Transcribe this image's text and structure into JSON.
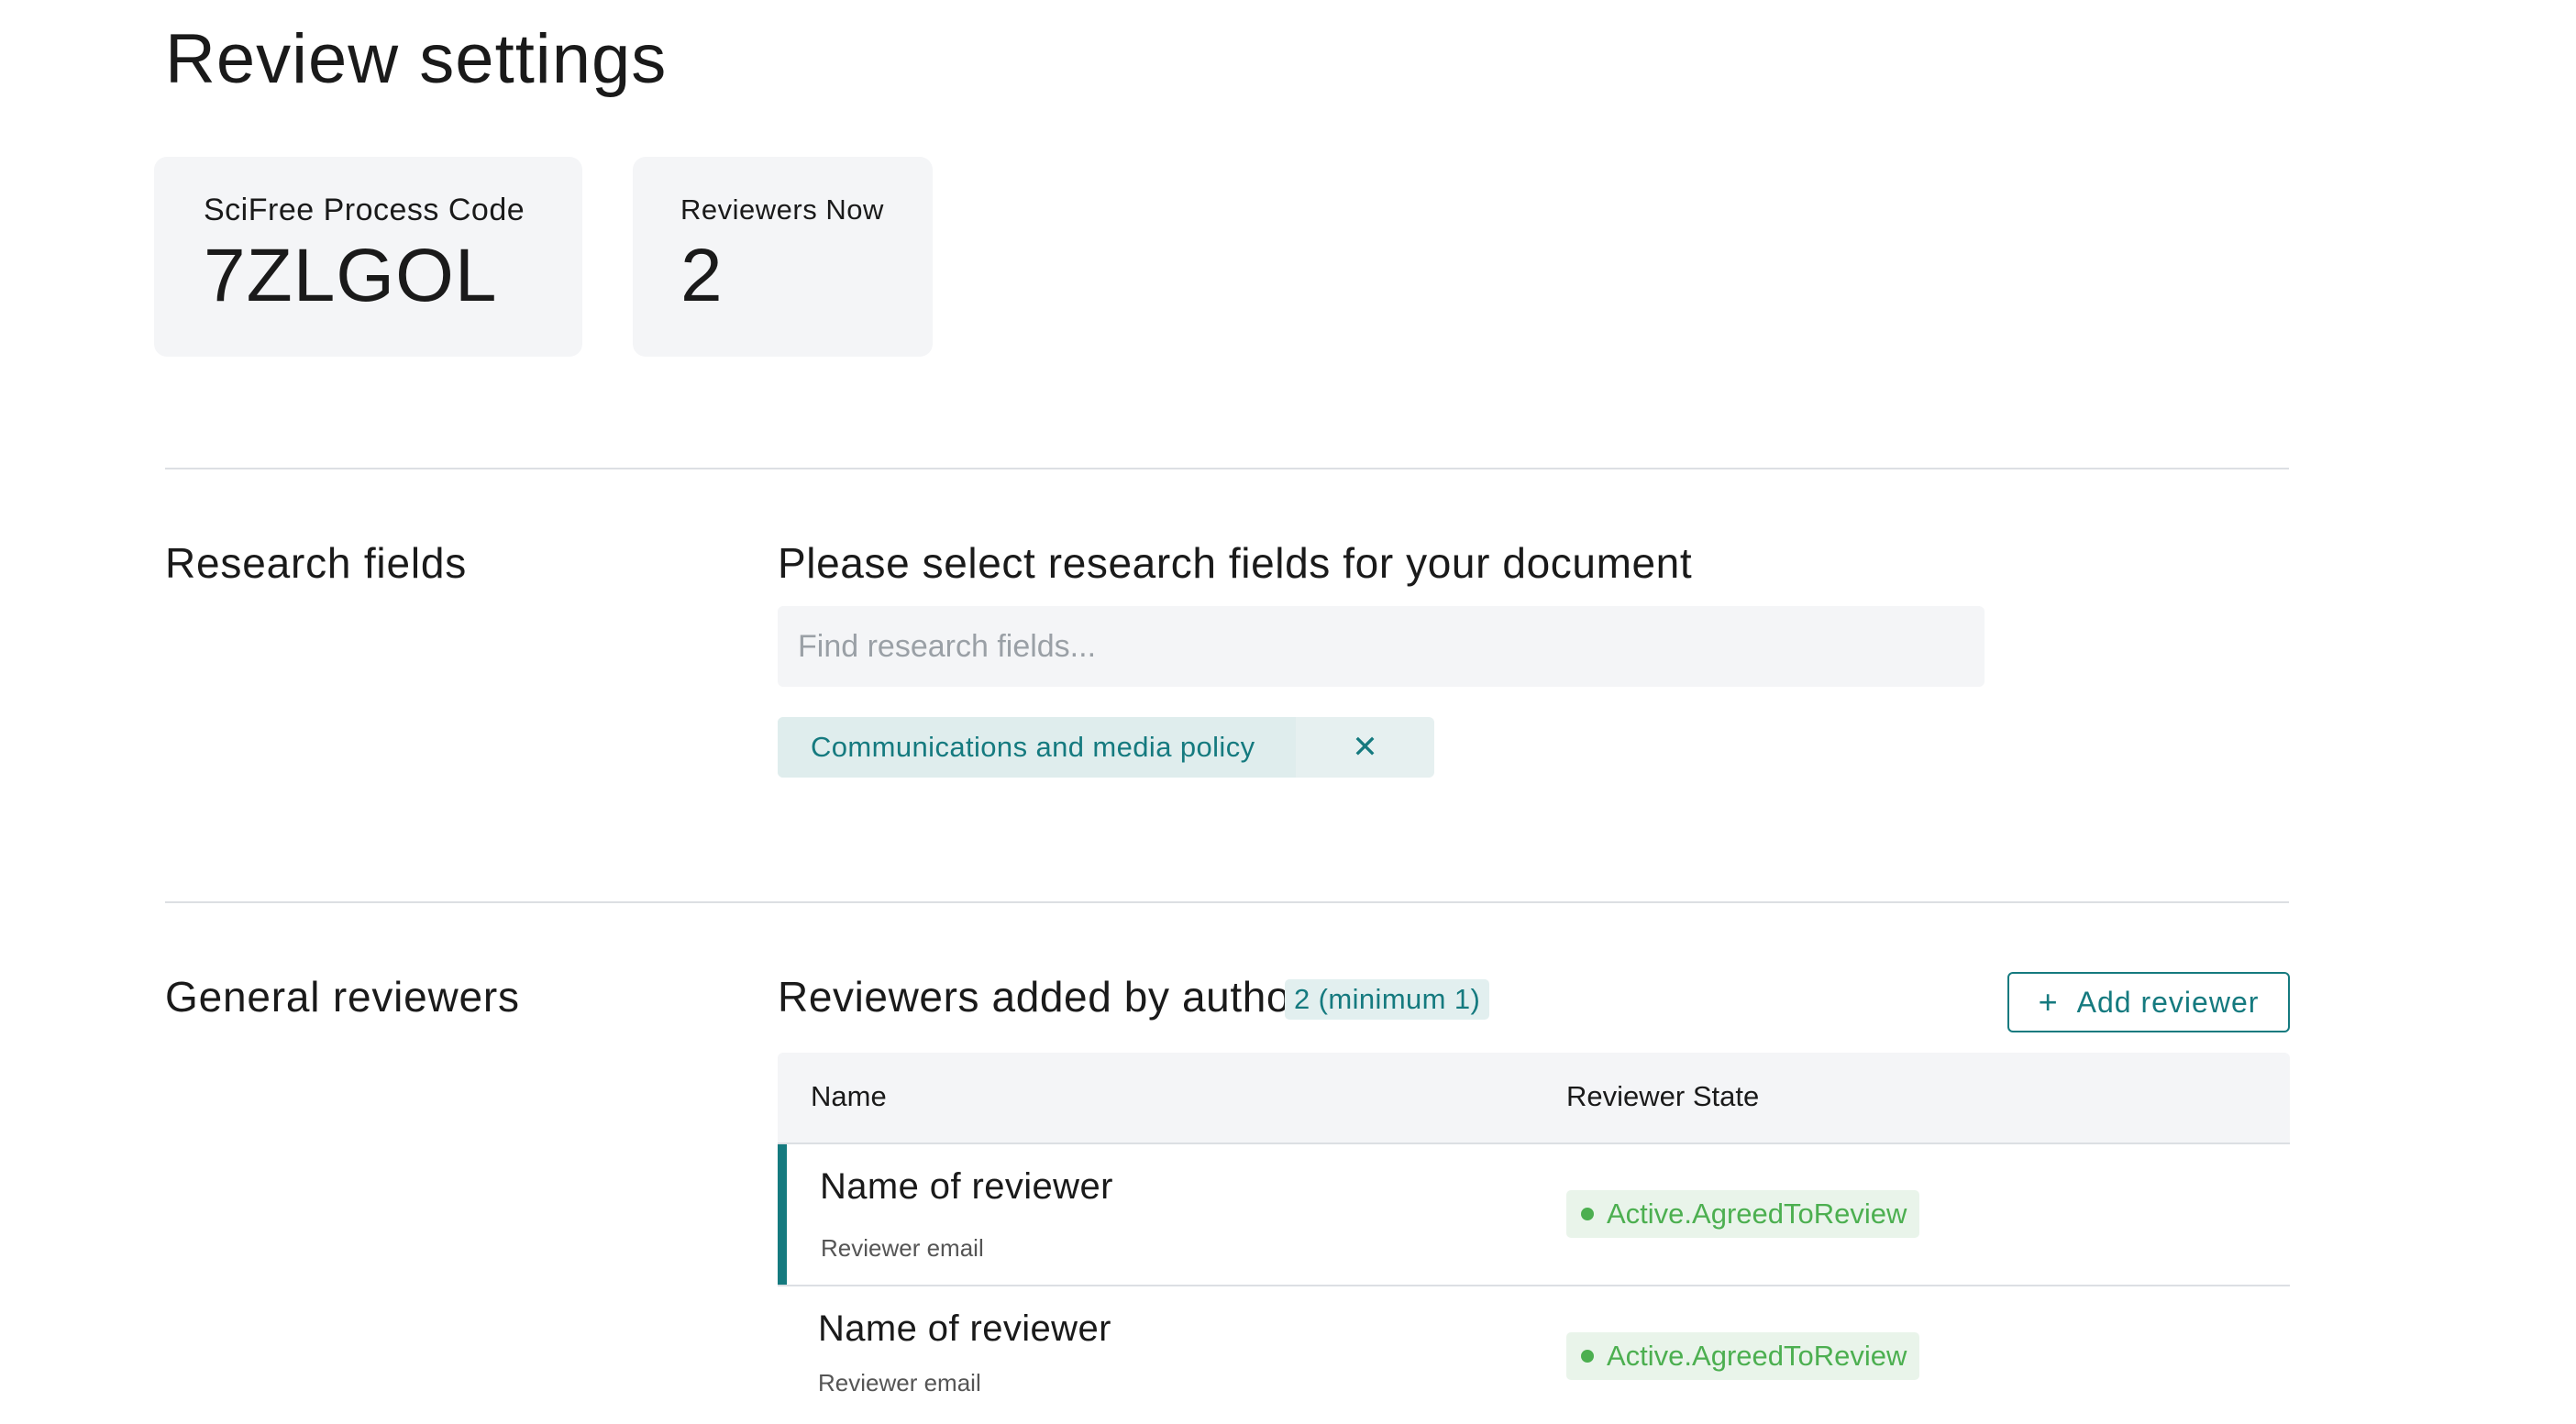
{
  "page": {
    "title": "Review settings"
  },
  "stats": {
    "process_code_label": "SciFree Process Code",
    "process_code_value": "7ZLGOL",
    "reviewers_now_label": "Reviewers Now",
    "reviewers_now_value": "2"
  },
  "research_fields": {
    "section_label": "Research fields",
    "heading": "Please select research fields for your document",
    "search_placeholder": "Find research fields...",
    "search_value": "",
    "selected": [
      {
        "label": "Communications and media policy",
        "remove_icon": "close-icon"
      }
    ]
  },
  "general_reviewers": {
    "section_label": "General reviewers",
    "heading": "Reviewers added by author",
    "count_badge": "2 (minimum 1)",
    "add_button_label": "Add reviewer",
    "add_button_icon": "plus-icon",
    "table": {
      "columns": [
        "Name",
        "Reviewer State"
      ],
      "rows": [
        {
          "name": "Name of reviewer",
          "email": "Reviewer email",
          "state": "Active.AgreedToReview"
        },
        {
          "name": "Name of reviewer",
          "email": "Reviewer email",
          "state": "Active.AgreedToReview"
        }
      ]
    }
  },
  "colors": {
    "accent": "#157a7f",
    "status_green": "#4caf50",
    "card_bg": "#f4f5f7"
  }
}
